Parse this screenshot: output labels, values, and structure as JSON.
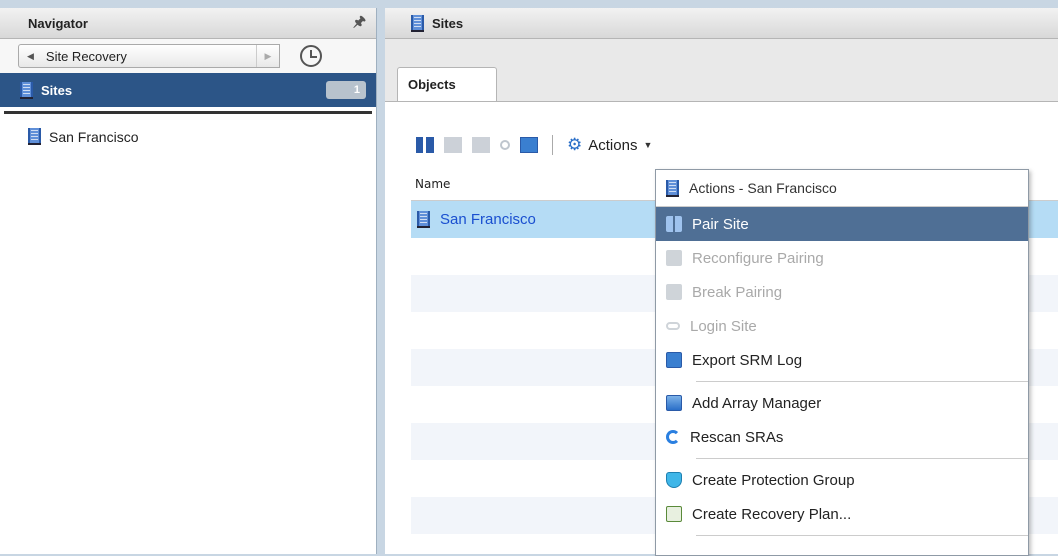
{
  "navigator": {
    "title": "Navigator",
    "back_label": "Site Recovery",
    "selected_item": {
      "label": "Sites",
      "count": "1"
    },
    "items": [
      {
        "label": "San Francisco"
      }
    ]
  },
  "main": {
    "title": "Sites",
    "tab": "Objects",
    "toolbar": {
      "actions_label": "Actions"
    },
    "grid": {
      "column_header": "Name",
      "rows": [
        {
          "name": "San Francisco"
        }
      ]
    }
  },
  "context_menu": {
    "header": "Actions - San Francisco",
    "items": [
      {
        "label": "Pair Site",
        "enabled": true,
        "icon": "pair-site-icon"
      },
      {
        "label": "Reconfigure Pairing",
        "enabled": false,
        "icon": "reconfigure-pairing-icon"
      },
      {
        "label": "Break Pairing",
        "enabled": false,
        "icon": "break-pairing-icon"
      },
      {
        "label": "Login Site",
        "enabled": false,
        "icon": "login-key-icon"
      },
      {
        "label": "Export SRM Log",
        "enabled": true,
        "icon": "export-log-icon"
      },
      {
        "label": "Add Array Manager",
        "enabled": true,
        "icon": "array-manager-icon"
      },
      {
        "label": "Rescan SRAs",
        "enabled": true,
        "icon": "rescan-icon"
      },
      {
        "label": "Create Protection Group",
        "enabled": true,
        "icon": "shield-icon"
      },
      {
        "label": "Create Recovery Plan...",
        "enabled": true,
        "icon": "recovery-plan-icon"
      }
    ]
  },
  "colors": {
    "selection_dark": "#2c5587",
    "row_selected": "#b5dcf5",
    "menu_highlight": "#4f6f95"
  }
}
